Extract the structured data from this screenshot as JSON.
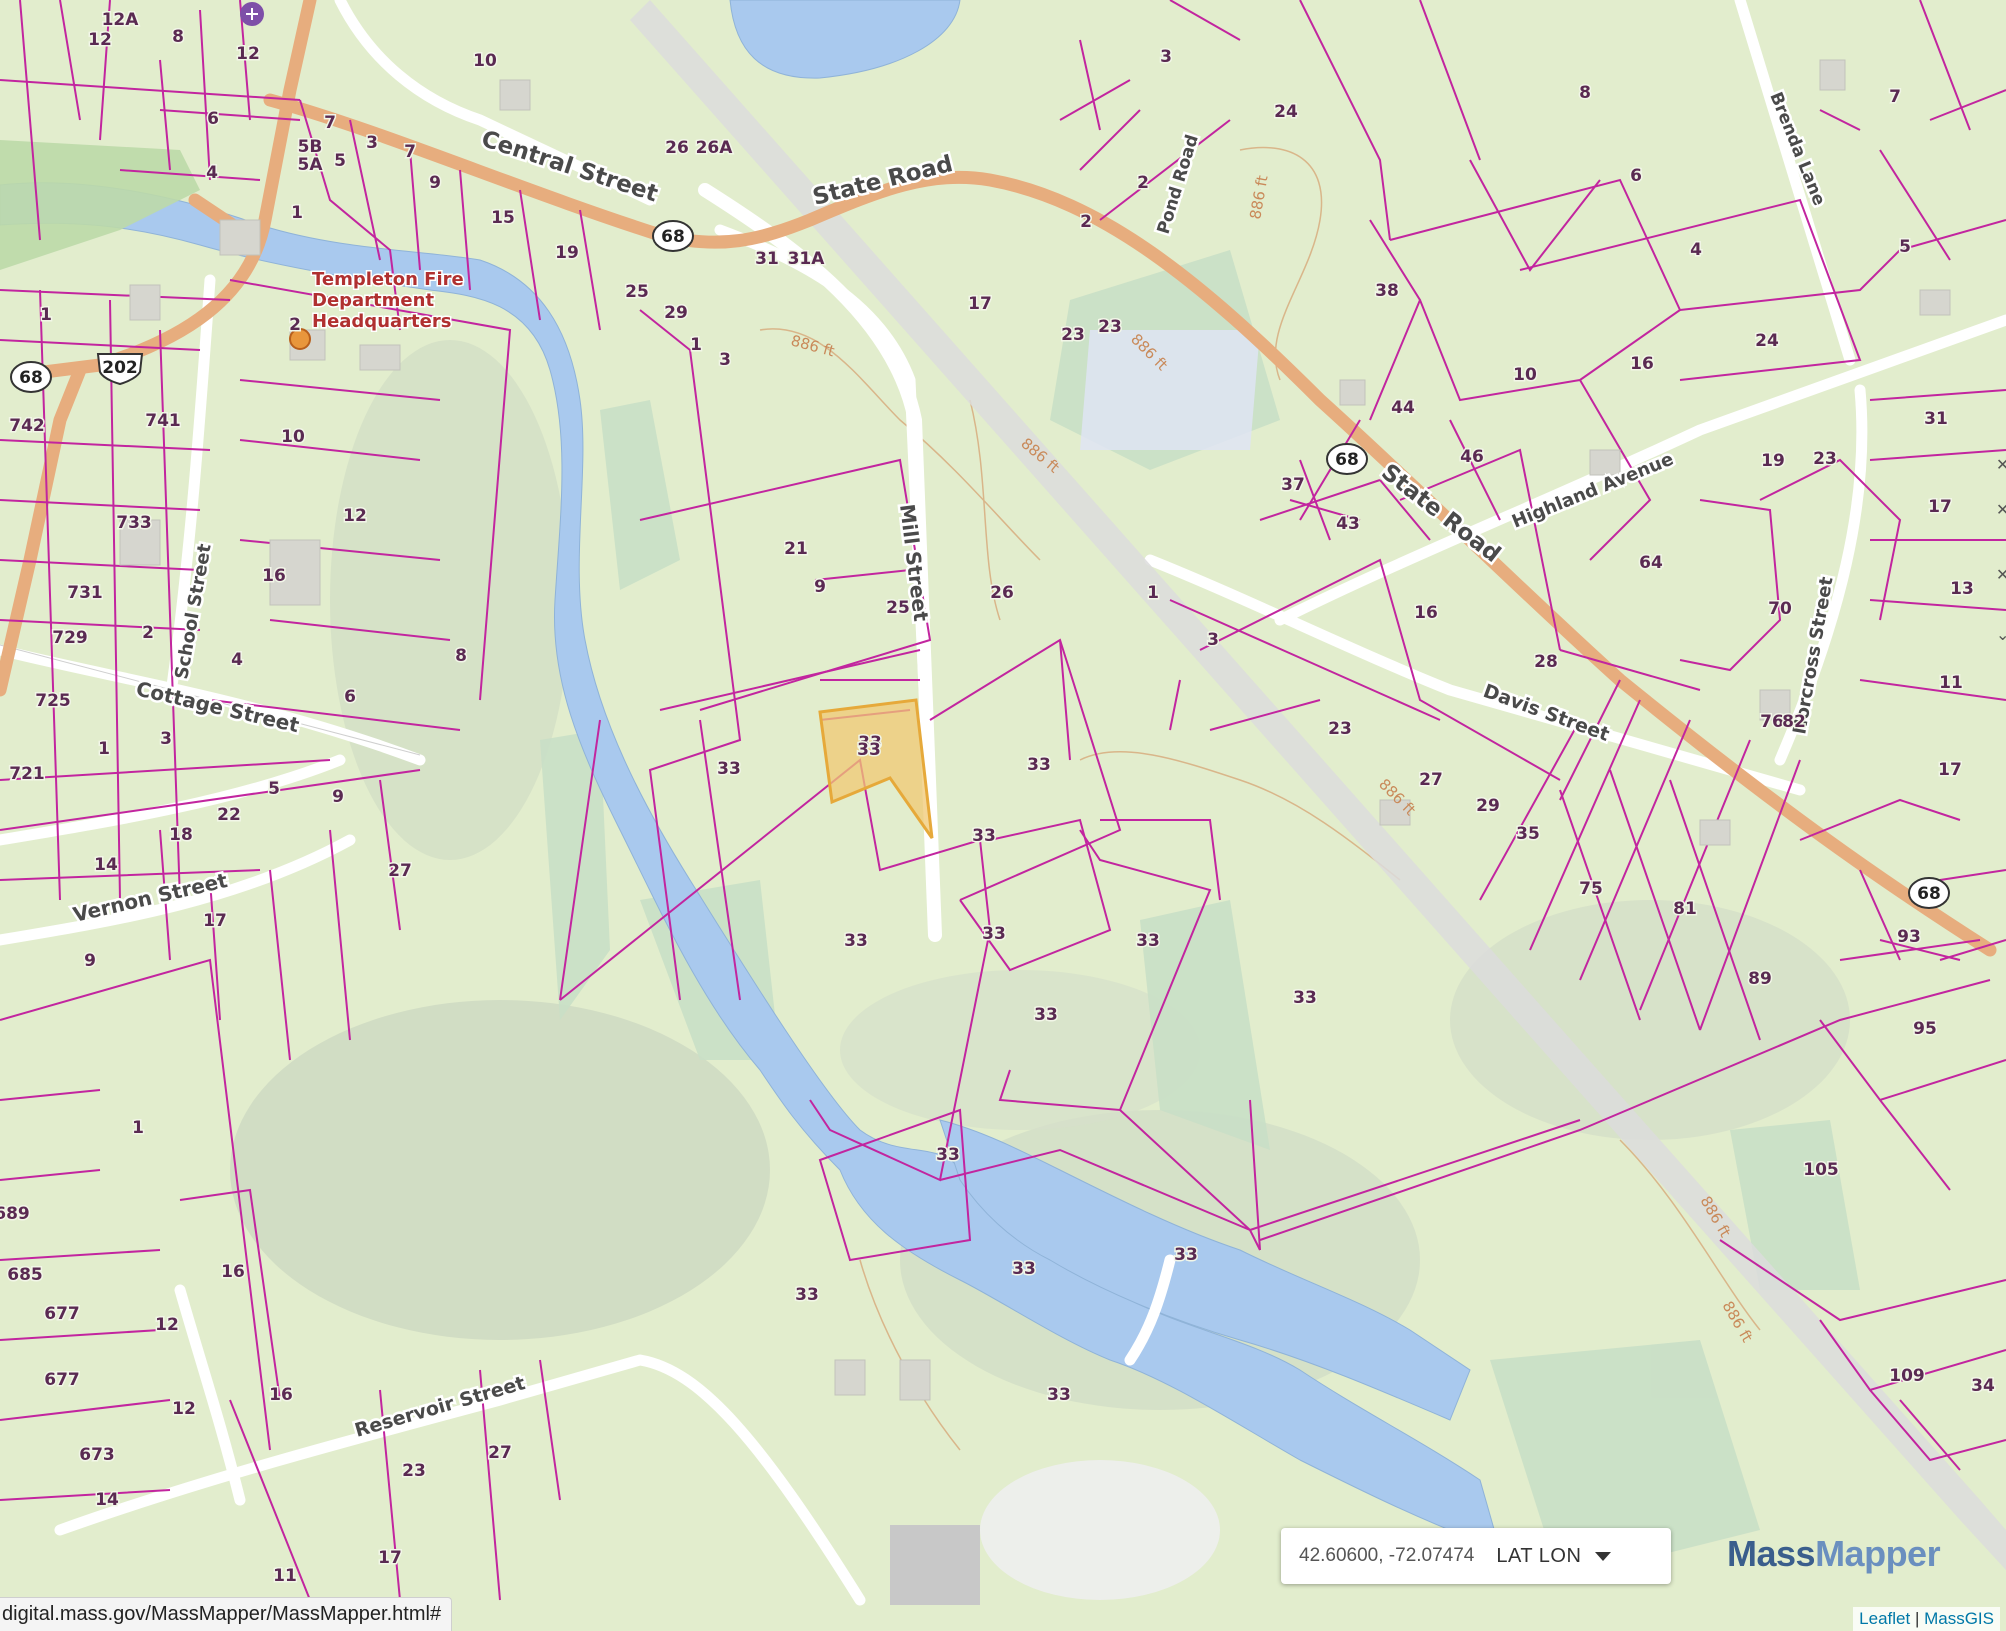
{
  "map": {
    "roads": {
      "central_street": "Central Street",
      "state_road_1": "State Road",
      "state_road_2": "State Road",
      "pond_road": "Pond Road",
      "mill_street": "Mill Street",
      "highland_avenue": "Highland Avenue",
      "school_street": "School Street",
      "cottage_street": "Cottage Street",
      "vernon_street": "Vernon Street",
      "davis_street": "Davis Street",
      "brenda_lane": "Brenda Lane",
      "norcross_street": "Norcross Street",
      "reservoir_street": "Reservoir Street"
    },
    "shields": [
      "68",
      "202",
      "68",
      "68",
      "68"
    ],
    "poi": {
      "line1": "Templeton Fire",
      "line2": "Department",
      "line3": "Headquarters"
    },
    "contours": [
      "886 ft",
      "886 ft",
      "886 ft",
      "886 ft",
      "886 ft",
      "886 ft",
      "886 ft"
    ],
    "parcels": [
      "12A",
      "12",
      "8",
      "12",
      "10",
      "6",
      "4",
      "7",
      "3",
      "7",
      "5B",
      "5A",
      "5",
      "9",
      "1",
      "15",
      "26",
      "26A",
      "19",
      "25",
      "29",
      "1",
      "3",
      "31",
      "31A",
      "1",
      "2",
      "742",
      "741",
      "10",
      "733",
      "12",
      "16",
      "731",
      "729",
      "2",
      "4",
      "725",
      "6",
      "1",
      "3",
      "721",
      "8",
      "5",
      "22",
      "9",
      "18",
      "14",
      "27",
      "17",
      "9",
      "1",
      "16",
      "12",
      "12",
      "16",
      "689",
      "685",
      "677",
      "677",
      "673",
      "23",
      "27",
      "11",
      "17",
      "14",
      "3",
      "24",
      "2",
      "2",
      "9",
      "17",
      "23",
      "23",
      "21",
      "25",
      "33",
      "33",
      "33",
      "33",
      "33",
      "33",
      "33",
      "33",
      "33",
      "33",
      "33",
      "33",
      "33",
      "33",
      "26",
      "37",
      "43",
      "38",
      "44",
      "46",
      "8",
      "6",
      "4",
      "10",
      "16",
      "24",
      "31",
      "19",
      "23",
      "17",
      "13",
      "64",
      "1",
      "3",
      "16",
      "28",
      "70",
      "76",
      "11",
      "82",
      "17",
      "23",
      "27",
      "29",
      "35",
      "75",
      "81",
      "89",
      "93",
      "95",
      "105",
      "109",
      "34",
      "5",
      "7"
    ],
    "highlight_parcel": "33"
  },
  "coord_widget": {
    "value": "42.60600, -72.07474",
    "mode": "LAT LON"
  },
  "brand": {
    "part1": "Mass",
    "part2": "Mapper"
  },
  "attribution": {
    "leaflet": "Leaflet",
    "sep": "|",
    "massgis": "MassGIS"
  },
  "status_url": "digital.mass.gov/MassMapper/MassMapper.html#",
  "colors": {
    "parcel_line": "#c2259f",
    "water": "#a9c9ee",
    "highlight": "#e6a93a",
    "highway": "#e7ad7e"
  }
}
